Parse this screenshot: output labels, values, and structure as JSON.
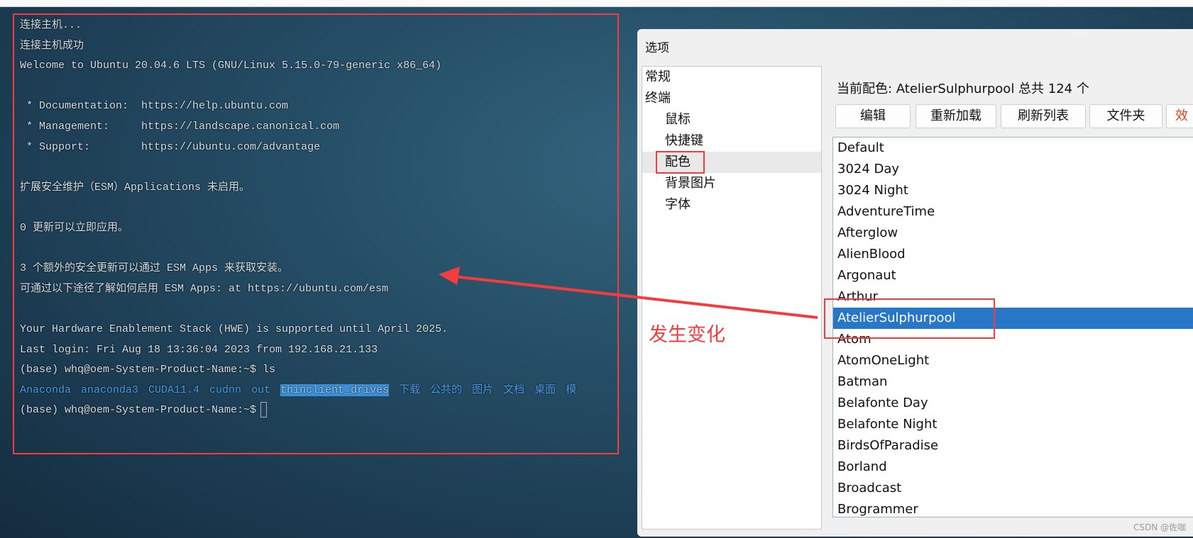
{
  "terminal": {
    "lines": [
      "连接主机...",
      "连接主机成功",
      "Welcome to Ubuntu 20.04.6 LTS (GNU/Linux 5.15.0-79-generic x86_64)",
      "",
      " * Documentation:  https://help.ubuntu.com",
      " * Management:     https://landscape.canonical.com",
      " * Support:        https://ubuntu.com/advantage",
      "",
      "扩展安全维护（ESM）Applications 未启用。",
      "",
      "0 更新可以立即应用。",
      "",
      "3 个额外的安全更新可以通过 ESM Apps 来获取安装。",
      "可通过以下途径了解如何启用 ESM Apps: at https://ubuntu.com/esm",
      "",
      "Your Hardware Enablement Stack (HWE) is supported until April 2025.",
      "Last login: Fri Aug 18 13:36:04 2023 from 192.168.21.133",
      "(base) whq@oem-System-Product-Name:~$ ls"
    ],
    "ls_output": [
      "Anaconda",
      "anaconda3",
      "CUDA11.4",
      "cudnn",
      "out",
      "thinclient_drives",
      "下载",
      "公共的",
      "图片",
      "文档",
      "桌面",
      "模"
    ],
    "prompt": "(base) whq@oem-System-Product-Name:~$"
  },
  "dialog": {
    "title": "选项",
    "tree": [
      {
        "label": "常规",
        "level": 0
      },
      {
        "label": "终端",
        "level": 0
      },
      {
        "label": "鼠标",
        "level": 1
      },
      {
        "label": "快捷键",
        "level": 1
      },
      {
        "label": "配色",
        "level": 1,
        "selected": true
      },
      {
        "label": "背景图片",
        "level": 1
      },
      {
        "label": "字体",
        "level": 1
      }
    ],
    "header": "当前配色: AtelierSulphurpool 总共 124 个",
    "buttons": [
      "编辑",
      "重新加载",
      "刷新列表",
      "文件夹",
      "效"
    ],
    "schemes": [
      "Default",
      "3024 Day",
      "3024 Night",
      "AdventureTime",
      "Afterglow",
      "AlienBlood",
      "Argonaut",
      "Arthur",
      "AtelierSulphurpool",
      "Atom",
      "AtomOneLight",
      "Batman",
      "Belafonte Day",
      "Belafonte Night",
      "BirdsOfParadise",
      "Borland",
      "Broadcast",
      "Brogrammer"
    ],
    "selected_scheme": "AtelierSulphurpool"
  },
  "annotation": {
    "text": "发生变化",
    "color": "#f33d3d"
  },
  "watermark": "CSDN @佐咖",
  "colors": {
    "selection": "#2876c6",
    "ls_dir": "#4a9be6"
  }
}
